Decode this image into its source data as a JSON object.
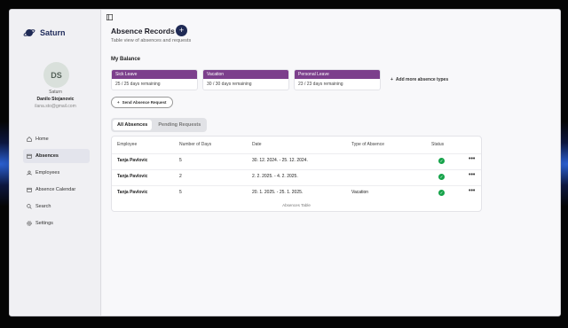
{
  "app": {
    "name": "Saturn"
  },
  "user": {
    "initials": "DS",
    "org": "Saturn",
    "name": "Danilo Stojanovic",
    "email": "ilana.sto@gmail.com"
  },
  "nav": [
    {
      "label": "Home",
      "icon": "home-icon"
    },
    {
      "label": "Absences",
      "icon": "calendar-icon",
      "active": true
    },
    {
      "label": "Employees",
      "icon": "users-icon"
    },
    {
      "label": "Absence Calendar",
      "icon": "calendar-icon"
    },
    {
      "label": "Search",
      "icon": "search-icon"
    },
    {
      "label": "Settings",
      "icon": "gear-icon"
    }
  ],
  "header": {
    "title": "Absence Records",
    "add_label": "+",
    "subtitle": "Table view of absences and requests"
  },
  "balance": {
    "title": "My Balance",
    "cards": [
      {
        "name": "Sick Leave",
        "remaining": "25 / 25 days remaining"
      },
      {
        "name": "Vacation",
        "remaining": "30 / 30 days remaining"
      },
      {
        "name": "Personal Leave",
        "remaining": "23 / 23 days remaining"
      }
    ],
    "add_more_label": "Add more absence types"
  },
  "send_request_label": "Send Absence Request",
  "tabs": [
    {
      "label": "All Absences",
      "active": true
    },
    {
      "label": "Pending Requests",
      "active": false
    }
  ],
  "table": {
    "columns": [
      "Employee",
      "Number of Days",
      "Date",
      "Type of Absence",
      "Status"
    ],
    "rows": [
      {
        "employee": "Tanja Pavlovic",
        "days": "5",
        "date": "30. 12. 2024. - 25. 12. 2024.",
        "type": "",
        "status": "approved"
      },
      {
        "employee": "Tanja Pavlovic",
        "days": "2",
        "date": "2. 2. 2025. - 4. 2. 2025.",
        "type": "",
        "status": "approved"
      },
      {
        "employee": "Tanja Pavlovic",
        "days": "5",
        "date": "20. 1. 2025. - 25. 1. 2025.",
        "type": "Vacation",
        "status": "approved"
      }
    ],
    "caption": "Absences Table",
    "more_label": "•••"
  },
  "colors": {
    "accent": "#7c3f8c",
    "brand": "#1f2a55",
    "success": "#16a34a"
  }
}
